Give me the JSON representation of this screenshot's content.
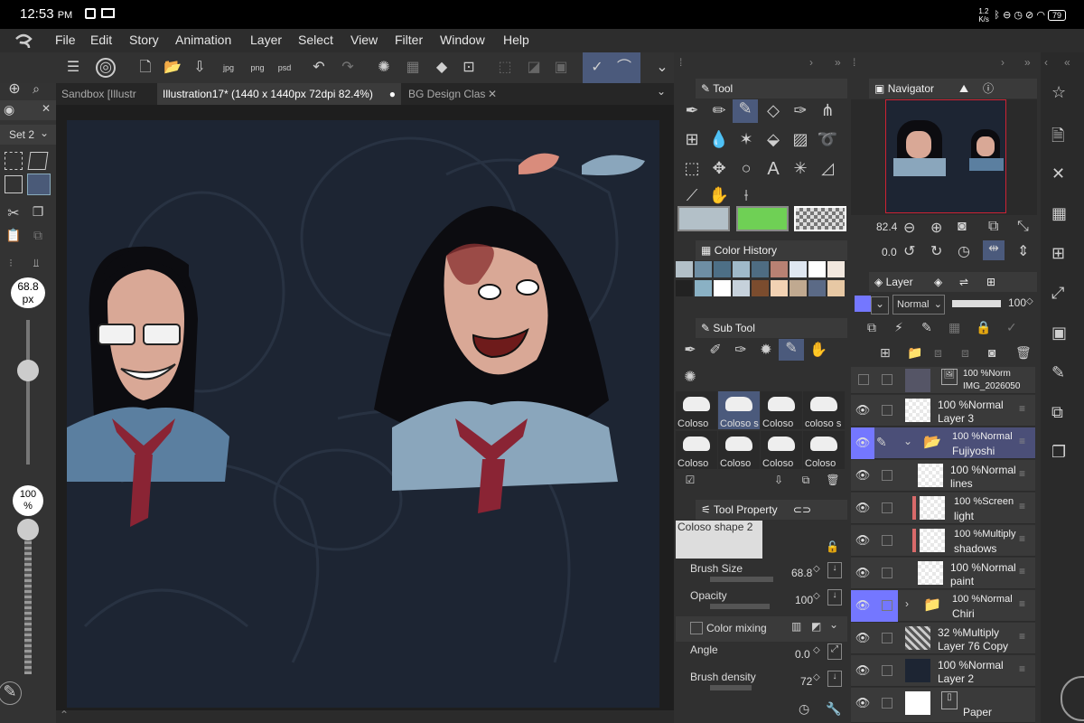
{
  "status": {
    "time": "12:53",
    "ampm": "PM",
    "net": "1.2\nK/s",
    "battery": "79"
  },
  "menu": [
    "File",
    "Edit",
    "Story",
    "Animation",
    "Layer",
    "Select",
    "View",
    "Filter",
    "Window",
    "Help"
  ],
  "tabs": [
    {
      "label": "Sandbox [Illustr"
    },
    {
      "label": "Illustration17* (1440 x 1440px 72dpi 82.4%)"
    },
    {
      "label": "BG Design Clas"
    }
  ],
  "left": {
    "set_label": "Set 2",
    "brush_size": "68.8",
    "brush_unit": "px",
    "opacity": "100",
    "opacity_unit": "%"
  },
  "tool_panel": {
    "title": "Tool"
  },
  "color_history": {
    "title": "Color History",
    "colors": [
      "#b3c0c8",
      "#6e8ea4",
      "#4d6f86",
      "#9fb9c9",
      "#4e6c82",
      "#b88173",
      "#dfe7f1",
      "#ffffff",
      "#f1e7de",
      "#222222",
      "#8ab1c4",
      "#ffffff",
      "#c6d1db",
      "#7b4c2e",
      "#f2d2b3",
      "#c0a990",
      "#5b6a86",
      "#e7c8a4"
    ]
  },
  "subtool": {
    "title": "Sub Tool",
    "items": [
      "Coloso",
      "Coloso s",
      "Coloso",
      "coloso s",
      "Coloso",
      "Coloso",
      "Coloso",
      "Coloso"
    ]
  },
  "tool_property": {
    "title": "Tool Property",
    "brush_name": "Coloso shape 2",
    "brush_size_label": "Brush Size",
    "brush_size": "68.8",
    "opacity_label": "Opacity",
    "opacity": "100",
    "color_mixing": "Color mixing",
    "angle_label": "Angle",
    "angle": "0.0",
    "density_label": "Brush density",
    "density": "72"
  },
  "navigator": {
    "title": "Navigator",
    "zoom": "82.4",
    "rotation": "0.0"
  },
  "layer_panel": {
    "title": "Layer",
    "blend": "Normal",
    "opacity": "100"
  },
  "layers": [
    {
      "pct": "100 %",
      "mode": "Norm",
      "name": "IMG_2026050"
    },
    {
      "pct": "100 %",
      "mode": "Normal",
      "name": "Layer 3"
    },
    {
      "pct": "100 %",
      "mode": "Normal",
      "name": "Fujiyoshi"
    },
    {
      "pct": "100 %",
      "mode": "Normal",
      "name": "lines"
    },
    {
      "pct": "100 %",
      "mode": "Screen",
      "name": "light"
    },
    {
      "pct": "100 %",
      "mode": "Multiply",
      "name": "shadows"
    },
    {
      "pct": "100 %",
      "mode": "Normal",
      "name": "paint"
    },
    {
      "pct": "100 %",
      "mode": "Normal",
      "name": "Chiri"
    },
    {
      "pct": "32 %",
      "mode": "Multiply",
      "name": "Layer 76 Copy"
    },
    {
      "pct": "100 %",
      "mode": "Normal",
      "name": "Layer 2"
    },
    {
      "pct": "",
      "mode": "",
      "name": "Paper"
    }
  ],
  "colors": {
    "main": "#b3c0c8",
    "sub": "#6fd055",
    "accent": "#7477ff"
  }
}
